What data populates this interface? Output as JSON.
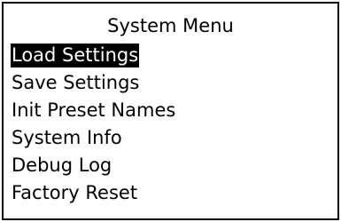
{
  "menu": {
    "title": "System Menu",
    "selected_index": 0,
    "items": [
      {
        "label": "Load Settings"
      },
      {
        "label": "Save Settings"
      },
      {
        "label": "Init Preset Names"
      },
      {
        "label": "System Info"
      },
      {
        "label": "Debug Log"
      },
      {
        "label": "Factory Reset"
      }
    ]
  },
  "colors": {
    "background": "#ffffff",
    "foreground": "#000000",
    "highlight_background": "#000000",
    "highlight_foreground": "#ffffff"
  }
}
